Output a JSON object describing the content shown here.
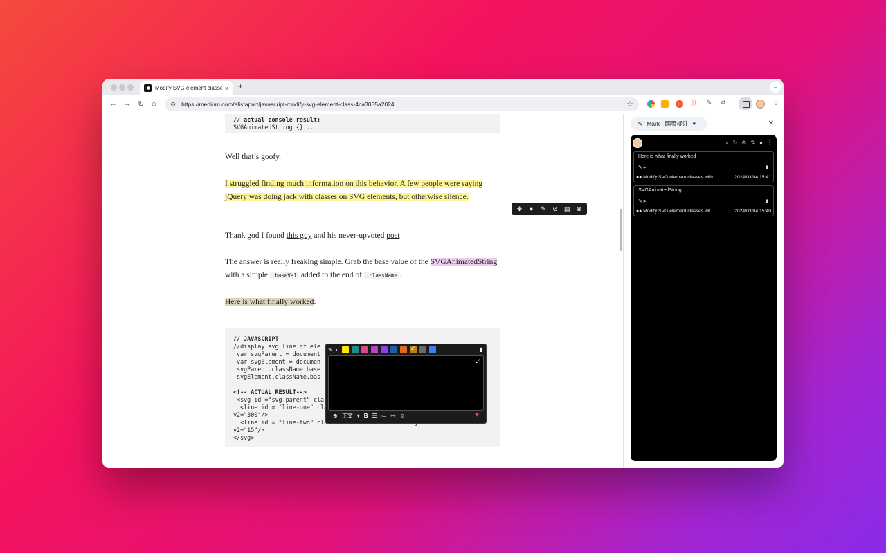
{
  "tab": {
    "title": "Modify SVG element classes",
    "close": "×",
    "new": "+"
  },
  "url": "https://medium.com/alistapart/javascript-modify-svg-element-class-4ca3055a2024",
  "article": {
    "code_top_1": "// actual console result:",
    "code_top_2": "SVGAnimatedString {} ..",
    "p1": "Well that’s goofy.",
    "p2": "I struggled finding much information on this behavior. A few people were saying jQuery was doing jack with classes on SVG elements, but otherwise silence.",
    "p3_a": "Thank god I found ",
    "p3_link1": "this guy",
    "p3_b": " and his never-upvoted ",
    "p3_link2": "post",
    "p4_a": "The answer is really freaking simple. Grab the base value of the ",
    "p4_hl": "SVGAnimatedString",
    "p4_b": " with a simple ",
    "p4_code1": ".baseVal",
    "p4_c": " added to the end of ",
    "p4_code2": ".className",
    "p4_d": ".",
    "p5_hl": "Here is what finally worked",
    "p5_b": ":",
    "code2": [
      "// JAVASCRIPT",
      "//display svg line of ele",
      " var svgParent = document",
      " var svgElement = documen",
      " svgParent.className.base",
      " svgElement.className.bas",
      "",
      "<!-- ACTUAL RESULT-->",
      " <svg id =\"svg-parent\" class = \"\" height=\"210\" width=\"500\">",
      "  <line id = \"line-one\" class = \"\" x1=\"15\" y1=\"15\"   x2=\"300\"",
      "y2=\"300\"/>",
      "  <line id = \"line-two\" class = \"invisible\" x1=\"15\" y1=\"300\" x2=\"300\"",
      "y2=\"15\"/>",
      "</svg>"
    ]
  },
  "popup": {
    "swatches": [
      "#ffe600",
      "#1f8c8c",
      "#d94a8a",
      "#c23fc2",
      "#8a3ff0",
      "#1a5fa8",
      "#e06a20",
      "#b8860b",
      "#6a6a6a",
      "#3b82f6"
    ],
    "selected_swatch": 7,
    "format_label": "正文"
  },
  "sidepanel": {
    "title": "Mark - 网页标注",
    "cards": [
      {
        "text": "Here is what finally worked",
        "source": "Modify SVG element classes with...",
        "time": "2024/03/04 15:41"
      },
      {
        "text": "SVGAnimatedString",
        "source": "Modify SVG element classes wit...",
        "time": "2024/03/04 15:40"
      }
    ]
  }
}
